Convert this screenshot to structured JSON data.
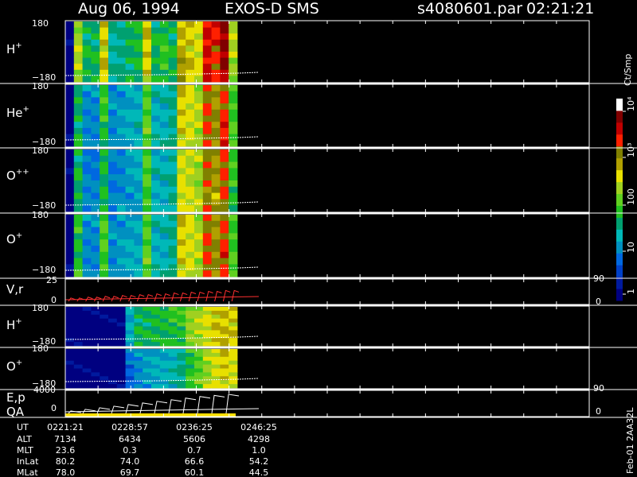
{
  "header": {
    "date": "Aug 06, 1994",
    "instrument": "EXOS-D SMS",
    "file": "s4080601.par",
    "time": "02:21:21"
  },
  "colorbar": {
    "unit": "Ct/Smp",
    "tick_labels": [
      "1",
      "10",
      "100",
      "10³",
      "10⁴"
    ],
    "colors": [
      "#000080",
      "#001a9e",
      "#0040c8",
      "#0068e0",
      "#0090c0",
      "#00b8b8",
      "#00a070",
      "#20c020",
      "#60d020",
      "#a0d020",
      "#e8e000",
      "#b0a000",
      "#808000",
      "#ff2000",
      "#c00000",
      "#800000",
      "#ffffff"
    ]
  },
  "panels": [
    {
      "label": "H",
      "sup": "+",
      "ytop": "180",
      "ybot": "−180"
    },
    {
      "label": "He",
      "sup": "+",
      "ytop": "180",
      "ybot": "−180"
    },
    {
      "label": "O",
      "sup": "++",
      "ytop": "180",
      "ybot": "−180"
    },
    {
      "label": "O",
      "sup": "+",
      "ytop": "180",
      "ybot": "−180"
    },
    {
      "label": "V,r",
      "sup": "",
      "ytop": "25",
      "ybot": "0",
      "right_top": "90",
      "right_bot": "0"
    },
    {
      "label": "H",
      "sup": "+",
      "ytop": "180",
      "ybot": "−180"
    },
    {
      "label": "O",
      "sup": "+",
      "ytop": "180",
      "ybot": "−180"
    },
    {
      "label": "E,p",
      "sup": "",
      "label2": "QA",
      "ytop": "4000",
      "ybot": "0",
      "right_top": "90",
      "right_bot": "0"
    }
  ],
  "ephemeris": {
    "row_labels": [
      "UT",
      "ALT",
      "MLT",
      "InLat",
      "MLat"
    ],
    "columns": [
      [
        "0221:21",
        "7134",
        "23.6",
        "80.2",
        "78.0"
      ],
      [
        "0228:57",
        "6434",
        "0.3",
        "74.0",
        "69.7"
      ],
      [
        "0236:25",
        "5606",
        "0.7",
        "66.6",
        "60.1"
      ],
      [
        "0246:25",
        "4298",
        "1.0",
        "54.2",
        "44.5"
      ]
    ]
  },
  "footer_note": "Feb-01 2AA32L",
  "chart_data": {
    "type": "heatmap",
    "title": "Aug 06, 1994   EXOS-D SMS",
    "x_tick_labels": [
      "0221:21",
      "0228:57",
      "0236:25",
      "0246:25"
    ],
    "color_scale": "log",
    "color_range": [
      1,
      10000
    ],
    "series": [
      {
        "name": "H+",
        "ylim": [
          -180,
          180
        ],
        "values": [
          1,
          200,
          40,
          40,
          400,
          25,
          30,
          40,
          50,
          400,
          40,
          60,
          40,
          600,
          400,
          300,
          3000,
          2000,
          5000,
          200
        ]
      },
      {
        "name": "He+",
        "ylim": [
          -180,
          180
        ],
        "values": [
          1,
          40,
          10,
          10,
          60,
          10,
          12,
          15,
          18,
          100,
          20,
          20,
          30,
          400,
          300,
          200,
          1500,
          800,
          2000,
          80
        ]
      },
      {
        "name": "O++",
        "ylim": [
          -180,
          180
        ],
        "values": [
          1,
          40,
          8,
          8,
          50,
          8,
          10,
          12,
          14,
          80,
          18,
          18,
          25,
          300,
          250,
          200,
          1200,
          700,
          1600,
          60
        ]
      },
      {
        "name": "O+",
        "ylim": [
          -180,
          180
        ],
        "values": [
          1,
          60,
          10,
          10,
          80,
          10,
          12,
          14,
          16,
          100,
          20,
          20,
          30,
          400,
          300,
          200,
          1500,
          800,
          1800,
          80
        ]
      },
      {
        "name": "V,r",
        "ylim": [
          0,
          25
        ],
        "values": [
          5,
          5,
          6,
          6,
          7,
          7,
          8,
          8,
          9,
          9,
          10,
          10,
          11,
          11,
          12,
          12,
          13,
          13,
          14,
          14
        ]
      },
      {
        "name": "H+",
        "ylim": [
          -180,
          180
        ],
        "values": [
          1,
          1,
          1,
          1,
          1,
          1,
          1,
          15,
          40,
          40,
          50,
          50,
          60,
          60,
          150,
          200,
          300,
          400,
          500,
          400
        ]
      },
      {
        "name": "O+",
        "ylim": [
          -180,
          180
        ],
        "values": [
          1,
          1,
          1,
          1,
          1,
          1,
          1,
          6,
          10,
          12,
          14,
          16,
          20,
          30,
          60,
          100,
          200,
          300,
          400,
          300
        ]
      },
      {
        "name": "E,p",
        "ylim": [
          0,
          4000
        ],
        "values": [
          600,
          900,
          1200,
          1500,
          1800,
          2100,
          2400,
          2700,
          3000,
          3300,
          3500,
          3700
        ]
      }
    ]
  }
}
